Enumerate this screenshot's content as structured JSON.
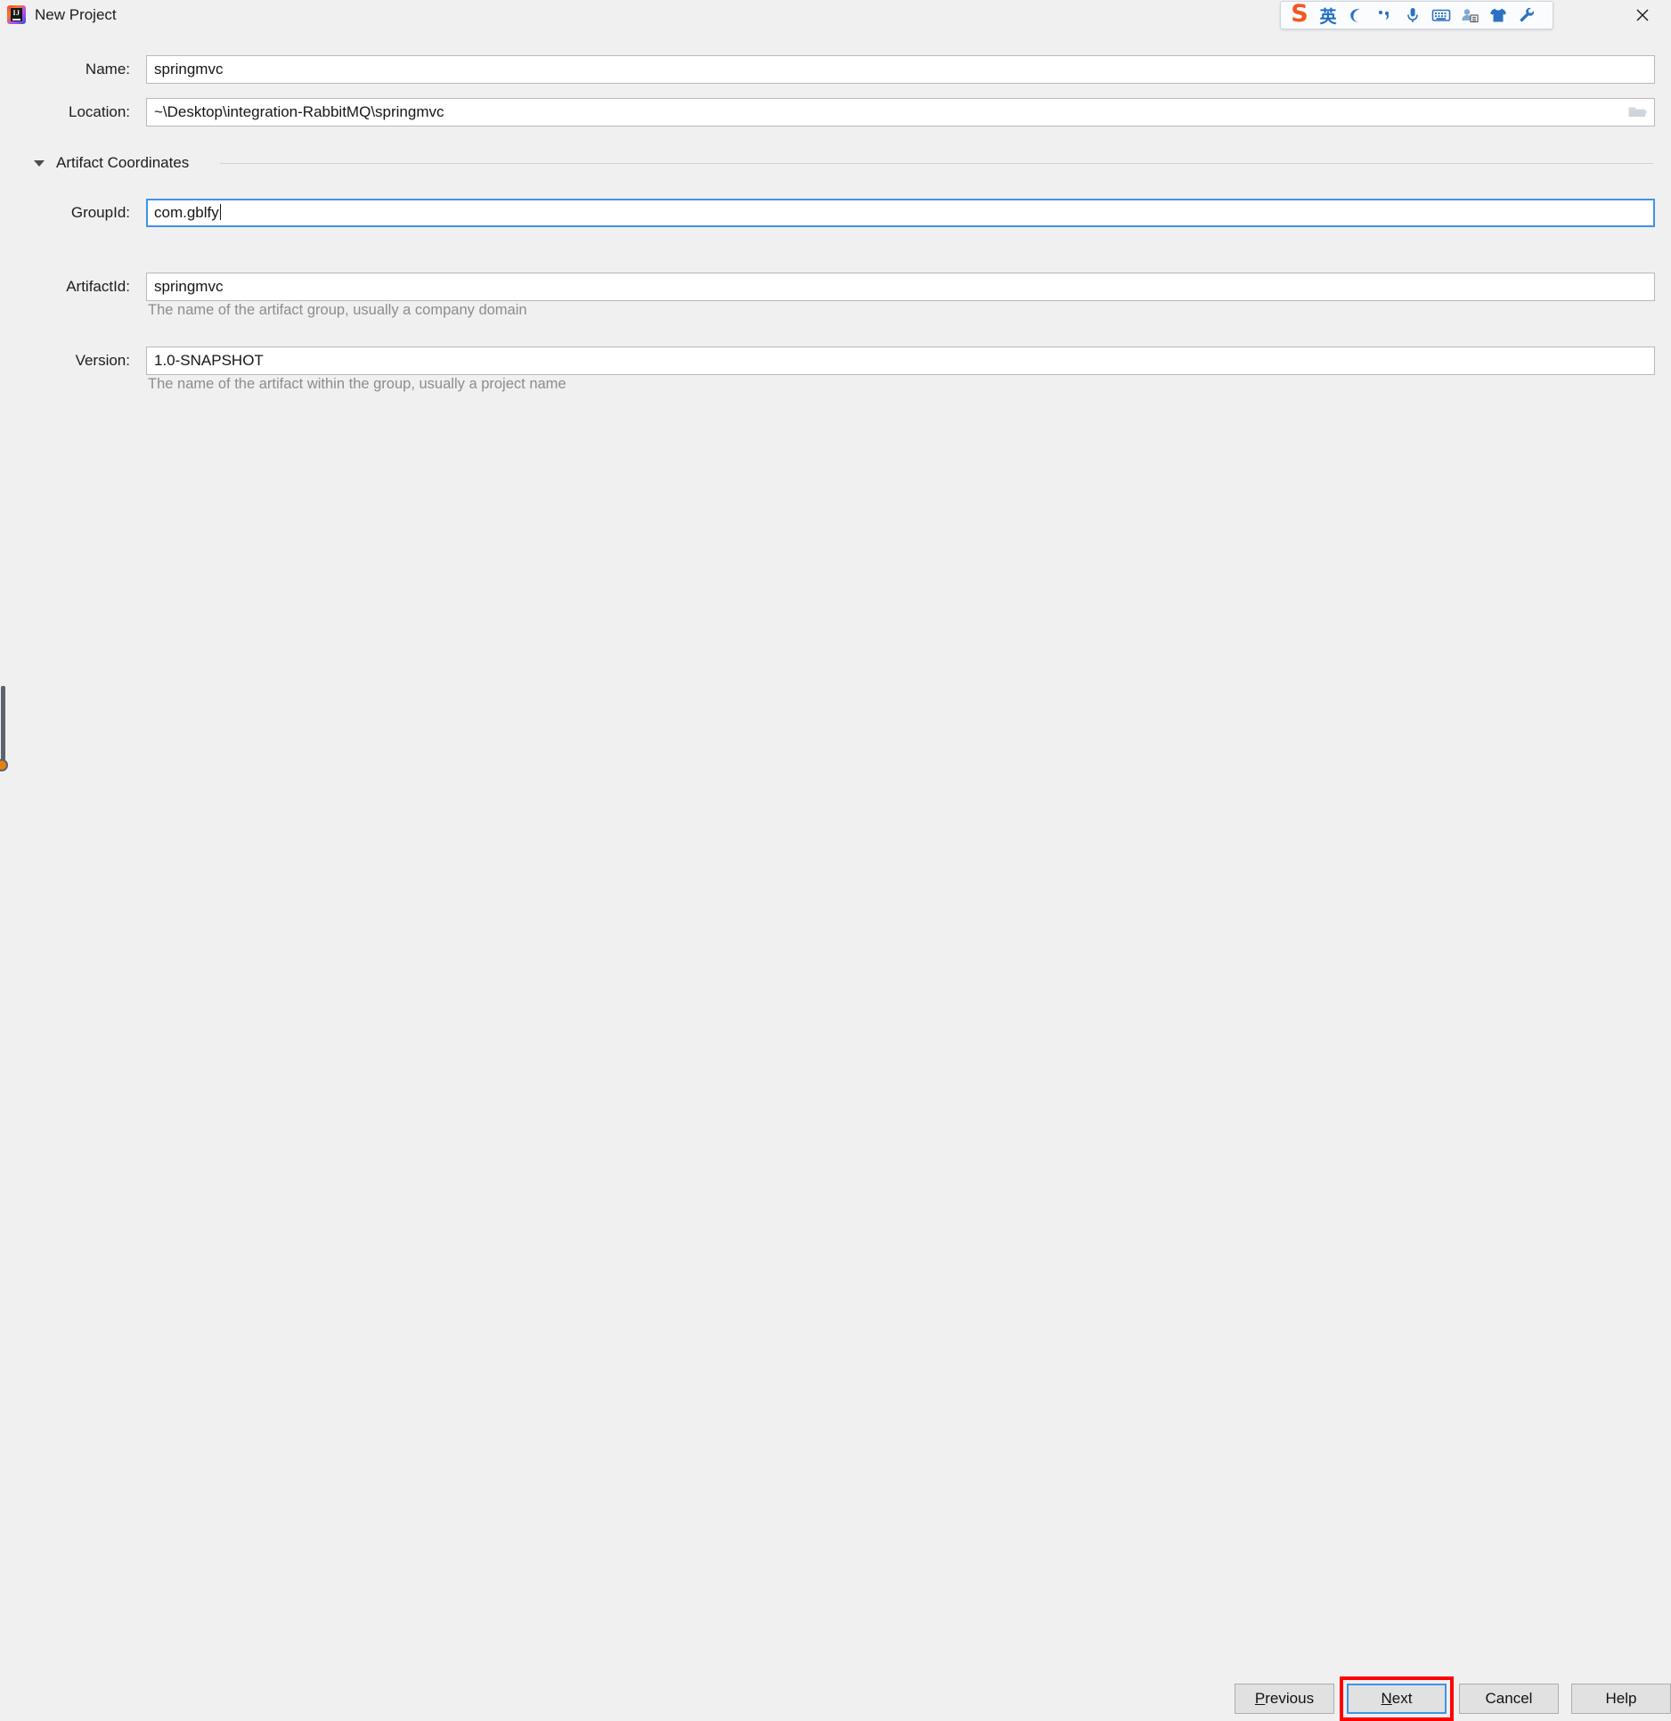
{
  "window": {
    "title": "New Project",
    "app_icon": "intellij-idea-icon",
    "close_icon": "close-icon"
  },
  "ime_toolbar": {
    "name": "sogou-ime-toolbar",
    "logo": "S",
    "mode_label": "英",
    "items": [
      {
        "icon": "sogou-logo-icon",
        "label": "S"
      },
      {
        "icon": "english-mode-icon",
        "label": "英"
      },
      {
        "icon": "moon-icon",
        "label": ""
      },
      {
        "icon": "punctuation-icon",
        "label": ""
      },
      {
        "icon": "microphone-icon",
        "label": ""
      },
      {
        "icon": "soft-keyboard-icon",
        "label": ""
      },
      {
        "icon": "user-dictionary-icon",
        "label": ""
      },
      {
        "icon": "skin-shirt-icon",
        "label": ""
      },
      {
        "icon": "tools-wrench-icon",
        "label": ""
      }
    ]
  },
  "form": {
    "name_label": "Name:",
    "name_value": "springmvc",
    "location_label": "Location:",
    "location_value": "~\\Desktop\\integration-RabbitMQ\\springmvc",
    "browse_icon": "folder-open-icon",
    "section_title": "Artifact Coordinates",
    "section_arrow_icon": "chevron-down-icon",
    "groupid_label": "GroupId:",
    "groupid_value": "com.gblfy",
    "groupid_hint": "The name of the artifact group, usually a company domain",
    "artifactid_label": "ArtifactId:",
    "artifactid_value": "springmvc",
    "artifactid_hint": "The name of the artifact within the group, usually a project name",
    "version_label": "Version:",
    "version_value": "1.0-SNAPSHOT"
  },
  "buttons": {
    "previous": {
      "mnemonic": "P",
      "rest": "revious"
    },
    "next": {
      "mnemonic": "N",
      "rest": "ext"
    },
    "cancel": {
      "label": "Cancel"
    },
    "help": {
      "label": "Help"
    }
  },
  "colors": {
    "background": "#f0f0f0",
    "field_border": "#b9b9b9",
    "focus_blue": "#3d94e8",
    "hint_text": "#8a8d91",
    "annotation_red": "#ff0000",
    "button_face": "#e1e1e1"
  }
}
